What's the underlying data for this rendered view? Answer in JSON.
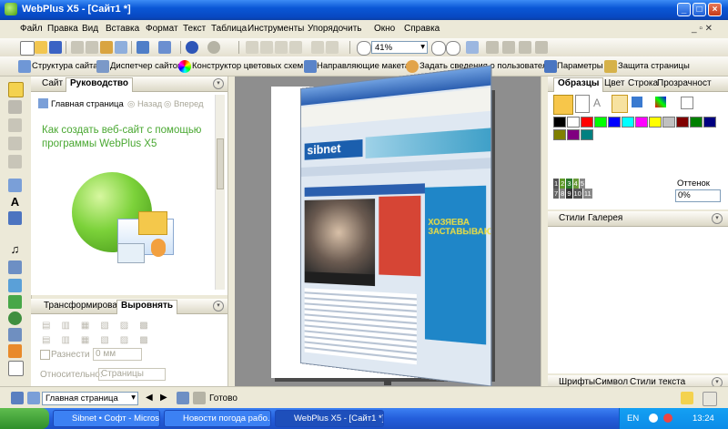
{
  "window": {
    "title": "WebPlus X5 - [Сайт1 *]"
  },
  "menu": [
    "Файл",
    "Правка",
    "Вид",
    "Вставка",
    "Формат",
    "Текст",
    "Таблица",
    "Инструменты",
    "Упорядочить",
    "Окно",
    "Справка"
  ],
  "zoom": "41%",
  "toolbar2": {
    "site_structure": "Структура сайта",
    "site_manager": "Диспетчер сайтов",
    "color_scheme": "Конструктор цветовых схем",
    "guides": "Направляющие макета",
    "user_details": "Задать сведения о пользователе",
    "parameters": "Параметры",
    "protection": "Защита страницы"
  },
  "left_panel": {
    "tab_site": "Сайт",
    "tab_content": "Руководство",
    "home": "Главная страница",
    "back": "Назад",
    "forward": "Вперед",
    "howto_title": "Как создать веб-сайт с помощью программы WebPlus X5"
  },
  "bottom_left_panel": {
    "tab_transform": "Трансформировать",
    "tab_align": "Выровнять",
    "spread_label": "Разнести",
    "spread_value": "0 мм",
    "relative_label": "Относительно:",
    "relative_value": "Страницы"
  },
  "right_panel": {
    "tabs": [
      "Образцы",
      "Цвет",
      "Строка",
      "Прозрачност"
    ],
    "tint_label": "Оттенок",
    "tint_value": "0%",
    "styles_tabs": [
      "Стили",
      "Галерея"
    ],
    "bottom_tabs": [
      "Шрифты",
      "Символ",
      "Стили текста"
    ]
  },
  "swatch_colors": [
    "#000000",
    "#ffffff",
    "#ff0000",
    "#00ff00",
    "#0000ff",
    "#00ffff",
    "#ff00ff",
    "#ffff00",
    "#c0c0c0",
    "#800000",
    "#008000",
    "#000080",
    "#808000",
    "#800080",
    "#008080"
  ],
  "statusbar": {
    "page": "Главная страница",
    "status": "Готово"
  },
  "taskbar": {
    "tasks": [
      "Sibnet • Софт - Micros...",
      "Новости погода рабо...",
      "WebPlus X5 - [Сайт1 *]"
    ],
    "lang": "EN",
    "clock": "13:24"
  },
  "screenshot_site": {
    "logo": "sibnet",
    "headline": "ХОЗЯЕВА ЗАСТАВЫВАЮТ"
  }
}
